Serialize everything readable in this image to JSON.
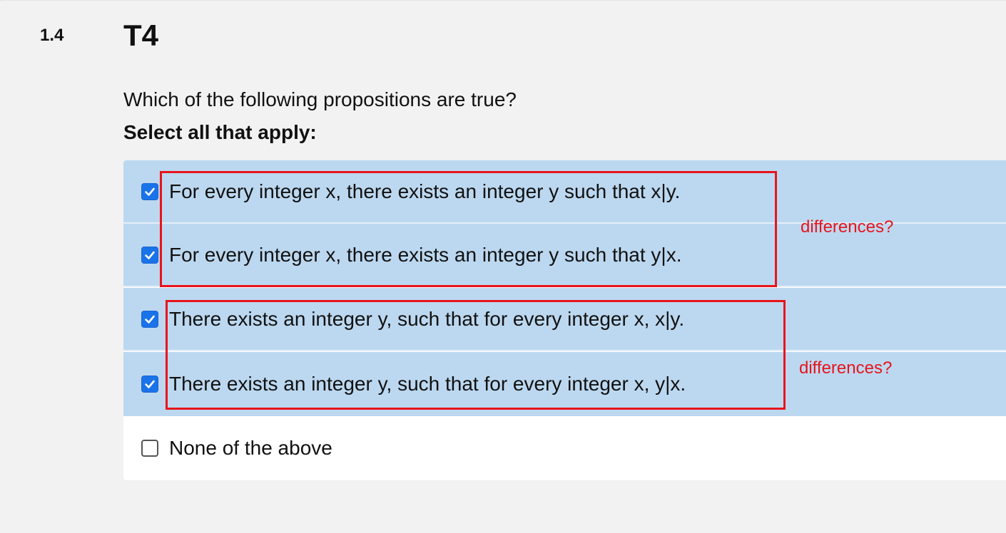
{
  "question": {
    "number": "1.4",
    "title": "T4",
    "prompt": "Which of the following propositions are true?",
    "instruction": "Select all that apply:"
  },
  "options": [
    {
      "label": "For every integer x, there exists an integer y such that x|y.",
      "checked": true
    },
    {
      "label": "For every integer x, there exists an integer y such that y|x.",
      "checked": true
    },
    {
      "label": "There exists an integer y, such that for every integer x, x|y.",
      "checked": true
    },
    {
      "label": "There exists an integer y, such that for every integer x, y|x.",
      "checked": true
    },
    {
      "label": "None of the above",
      "checked": false
    }
  ],
  "annotations": [
    {
      "text": "differences?",
      "color": "#e8141b"
    },
    {
      "text": "differences?",
      "color": "#e8141b"
    }
  ],
  "colors": {
    "selected_bg": "#bcd8f0",
    "checkbox_checked": "#1a73e8",
    "annotation": "#e8141b",
    "page_bg": "#f2f2f2"
  }
}
